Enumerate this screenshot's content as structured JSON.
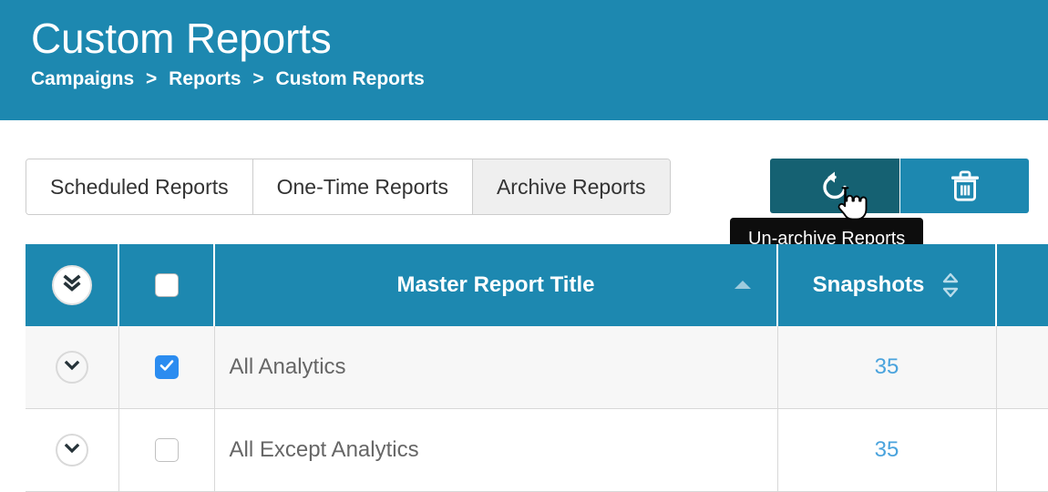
{
  "header": {
    "title": "Custom Reports",
    "breadcrumb": [
      {
        "label": "Campaigns"
      },
      {
        "label": "Reports"
      },
      {
        "label": "Custom Reports"
      }
    ],
    "separator": ">",
    "background_color": "#1d88b0"
  },
  "tabs": [
    {
      "label": "Scheduled Reports",
      "active": false
    },
    {
      "label": "One-Time Reports",
      "active": false
    },
    {
      "label": "Archive Reports",
      "active": true
    }
  ],
  "actions": [
    {
      "name": "un-archive",
      "icon": "undo-icon",
      "hovered": true,
      "color": "#156172"
    },
    {
      "name": "delete",
      "icon": "trash-icon",
      "hovered": false,
      "color": "#1d88b0"
    }
  ],
  "tooltip": {
    "text": "Un-archive Reports",
    "background_color": "#0d0d0d",
    "text_color": "#ffffff"
  },
  "table": {
    "header": {
      "expand_all_icon": "double-chevron-down-icon",
      "select_all_checked": false,
      "columns": [
        {
          "label": "Master Report Title",
          "sort": "ascending"
        },
        {
          "label": "Snapshots",
          "sort": "none"
        }
      ]
    },
    "rows": [
      {
        "checked": true,
        "title": "All Analytics",
        "snapshots": "35",
        "expand_icon": "chevron-down-icon",
        "striped": true
      },
      {
        "checked": false,
        "title": "All Except Analytics",
        "snapshots": "35",
        "expand_icon": "chevron-down-icon",
        "striped": false
      }
    ]
  },
  "cursor": {
    "type": "pointer-hand-cursor"
  },
  "colors": {
    "brand_blue": "#1d88b0",
    "brand_blue_dark": "#156172",
    "link_blue": "#4aa3dd",
    "checkbox_blue": "#2b8cf0",
    "row_stripe": "#f7f7f7"
  }
}
